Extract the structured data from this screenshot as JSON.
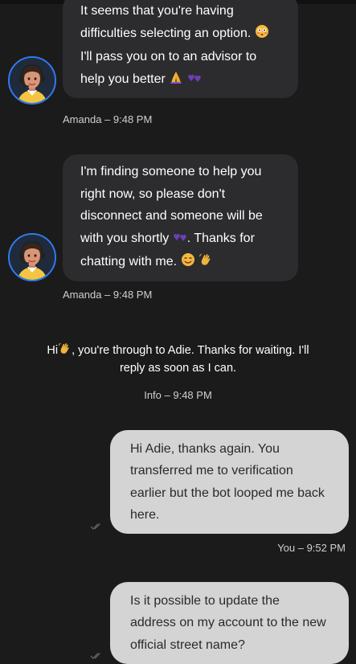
{
  "messages": [
    {
      "id": "bot1",
      "sender": "Amanda",
      "time": "9:48 PM",
      "meta": "Amanda – 9:48 PM",
      "lines": [
        "It seems that you're having",
        "difficulties selecting an option.",
        "I'll pass you on to an advisor to",
        "help you better"
      ]
    },
    {
      "id": "bot2",
      "sender": "Amanda",
      "time": "9:48 PM",
      "meta": "Amanda – 9:48 PM",
      "lines": [
        "I'm finding someone to help you",
        "right now, so please don't",
        "disconnect and someone will be",
        "with you shortly",
        ". Thanks for",
        "chatting with me."
      ]
    },
    {
      "id": "info1",
      "sender": "Info",
      "time": "9:48 PM",
      "meta": "Info – 9:48 PM",
      "line1_prefix": "Hi",
      "line1_rest": ", you're through to Adie. Thanks for waiting. I'll",
      "line2": "reply as soon as I can."
    },
    {
      "id": "user1",
      "sender": "You",
      "time": "9:52 PM",
      "meta": "You – 9:52 PM",
      "lines": [
        "Hi Adie, thanks again. You",
        "transferred me to verification",
        "earlier but the bot looped me back",
        "here."
      ]
    },
    {
      "id": "user2",
      "sender": "You",
      "lines": [
        "Is it possible to update the",
        "address on my account to the new",
        "official street name?"
      ]
    }
  ],
  "icons": {
    "avatar": "agent-avatar-headset-icon",
    "flushed": "flushed-face-emoji",
    "pray": "folded-hands-emoji",
    "hearts": "purple-hearts-emoji",
    "smile": "smiling-face-emoji",
    "wave": "waving-hand-emoji",
    "read": "double-check-read-icon"
  },
  "colors": {
    "background": "#1b1b1c",
    "bot_bubble": "#2c2c2e",
    "user_bubble": "#d4d4d4",
    "avatar_ring": "#2d7cf0"
  }
}
